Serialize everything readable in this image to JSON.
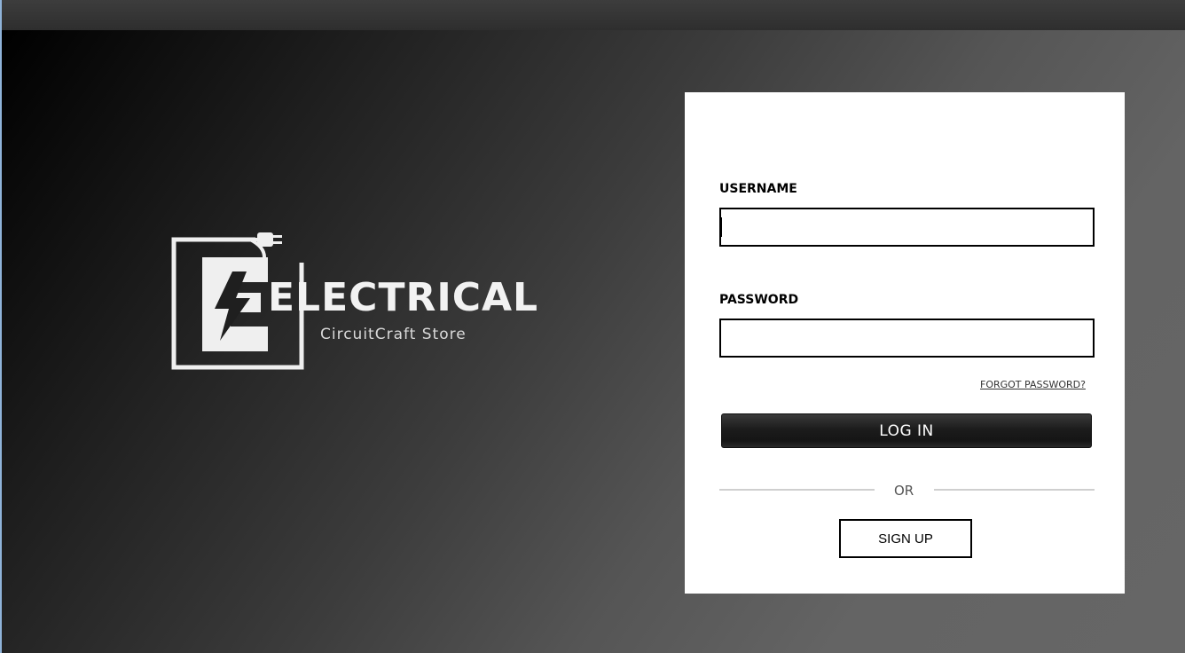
{
  "brand": {
    "title": "ELECTRICAL",
    "subtitle": "CircuitCraft Store",
    "logo_icon": "plug-lightning-icon"
  },
  "login": {
    "username_label": "USERNAME",
    "username_value": "",
    "password_label": "PASSWORD",
    "password_value": "",
    "forgot_password": "FORGOT PASSWORD?",
    "login_button": "LOG IN",
    "or_text": "OR",
    "signup_button": "SIGN UP"
  },
  "colors": {
    "card_background": "#ffffff",
    "login_button": "#1c1c1c",
    "backdrop_dark": "#000000",
    "backdrop_light": "#666666"
  }
}
